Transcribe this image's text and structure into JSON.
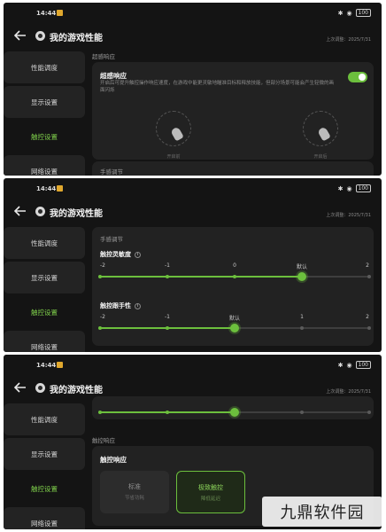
{
  "status": {
    "time": "14:44",
    "battery": "100"
  },
  "header": {
    "title": "我的游戏性能",
    "updated": "上次调整：2025/7/31"
  },
  "sidebar": {
    "items": [
      {
        "label": "性能调度"
      },
      {
        "label": "显示设置"
      },
      {
        "label": "触控设置"
      },
      {
        "label": "网络设置"
      }
    ]
  },
  "screen1": {
    "section": "超感响应",
    "card_title": "超感响应",
    "desc": "开启后可提升触控操作响应速度，在游戏中能更灵敏地瞄准目标和释放技能，但部分场景可能会产生轻微的画面闪烁",
    "toggle_on": true,
    "illus_left_caption": "开启前",
    "illus_right_caption": "开启后",
    "next_section": "手感调节"
  },
  "screen2": {
    "section": "手感调节",
    "sensitivity": {
      "title": "触控灵敏度",
      "ticks": [
        "-2",
        "-1",
        "0",
        "默认",
        "2"
      ],
      "selected_index": 3
    },
    "follow": {
      "title": "触控跟手性",
      "ticks": [
        "-2",
        "-1",
        "默认",
        "1",
        "2"
      ],
      "selected_index": 2
    }
  },
  "screen3": {
    "section": "触控响应",
    "card_title": "触控响应",
    "options": [
      {
        "label": "标准",
        "sub": "节省功耗",
        "selected": false
      },
      {
        "label": "极致触控",
        "sub": "降低延迟",
        "selected": true
      }
    ]
  },
  "watermark": "九鼎软件园",
  "colors": {
    "accent": "#6cbf3d",
    "bg": "#141414",
    "card": "#222222"
  }
}
